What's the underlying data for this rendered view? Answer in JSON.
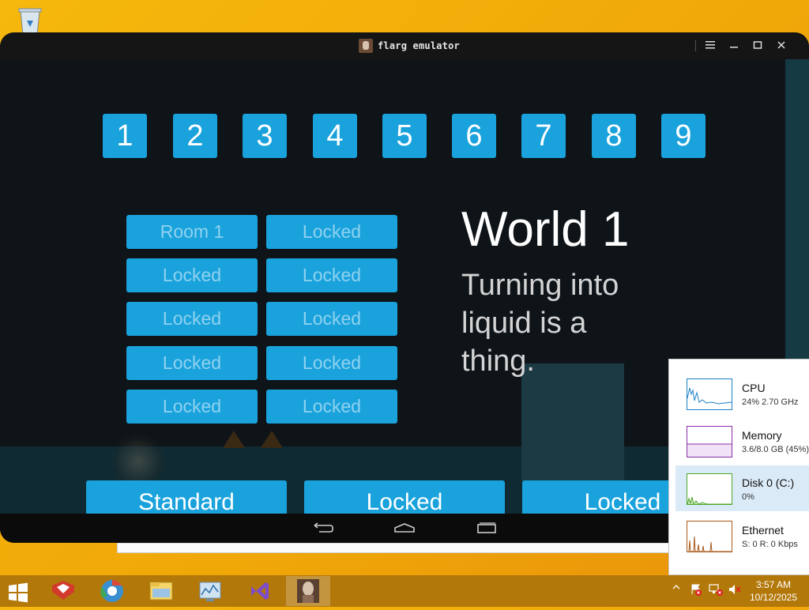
{
  "desktop": {
    "recycle_bin_icon": "recycle-bin-icon"
  },
  "window": {
    "title": "flarg emulator",
    "menu_icon": "menu-icon",
    "minimize": "minimize-icon",
    "maximize": "maximize-icon",
    "close": "close-icon"
  },
  "game": {
    "world_tabs": [
      "1",
      "2",
      "3",
      "4",
      "5",
      "6",
      "7",
      "8",
      "9"
    ],
    "rooms": [
      "Room 1",
      "Locked",
      "Locked",
      "Locked",
      "Locked",
      "Locked",
      "Locked",
      "Locked",
      "Locked",
      "Locked"
    ],
    "world_title": "World 1",
    "world_description": "Turning into liquid is a thing.",
    "modes": [
      "Standard",
      "Locked",
      "Locked"
    ],
    "accent_color": "#1aa2dc"
  },
  "nav": {
    "back": "back-icon",
    "home": "home-icon",
    "recents": "recents-icon"
  },
  "perf_monitor": [
    {
      "name": "CPU",
      "value": "24% 2.70 GHz",
      "color": "#1c7fc6"
    },
    {
      "name": "Memory",
      "value": "3.6/8.0 GB (45%)",
      "color": "#8b2fa6"
    },
    {
      "name": "Disk 0 (C:)",
      "value": "0%",
      "color": "#4ea72a"
    },
    {
      "name": "Ethernet",
      "value": "S: 0 R: 0 Kbps",
      "color": "#a7581a"
    }
  ],
  "taskbar": {
    "apps": [
      "gift-app-icon",
      "chrome-browser-icon",
      "file-explorer-icon",
      "task-manager-icon",
      "visual-studio-icon",
      "flarg-emulator-icon"
    ],
    "tray_icons": [
      "show-hidden-icons-icon",
      "action-center-icon",
      "network-icon",
      "volume-muted-icon"
    ],
    "time": "3:57 AM",
    "date": "10/12/2025"
  }
}
